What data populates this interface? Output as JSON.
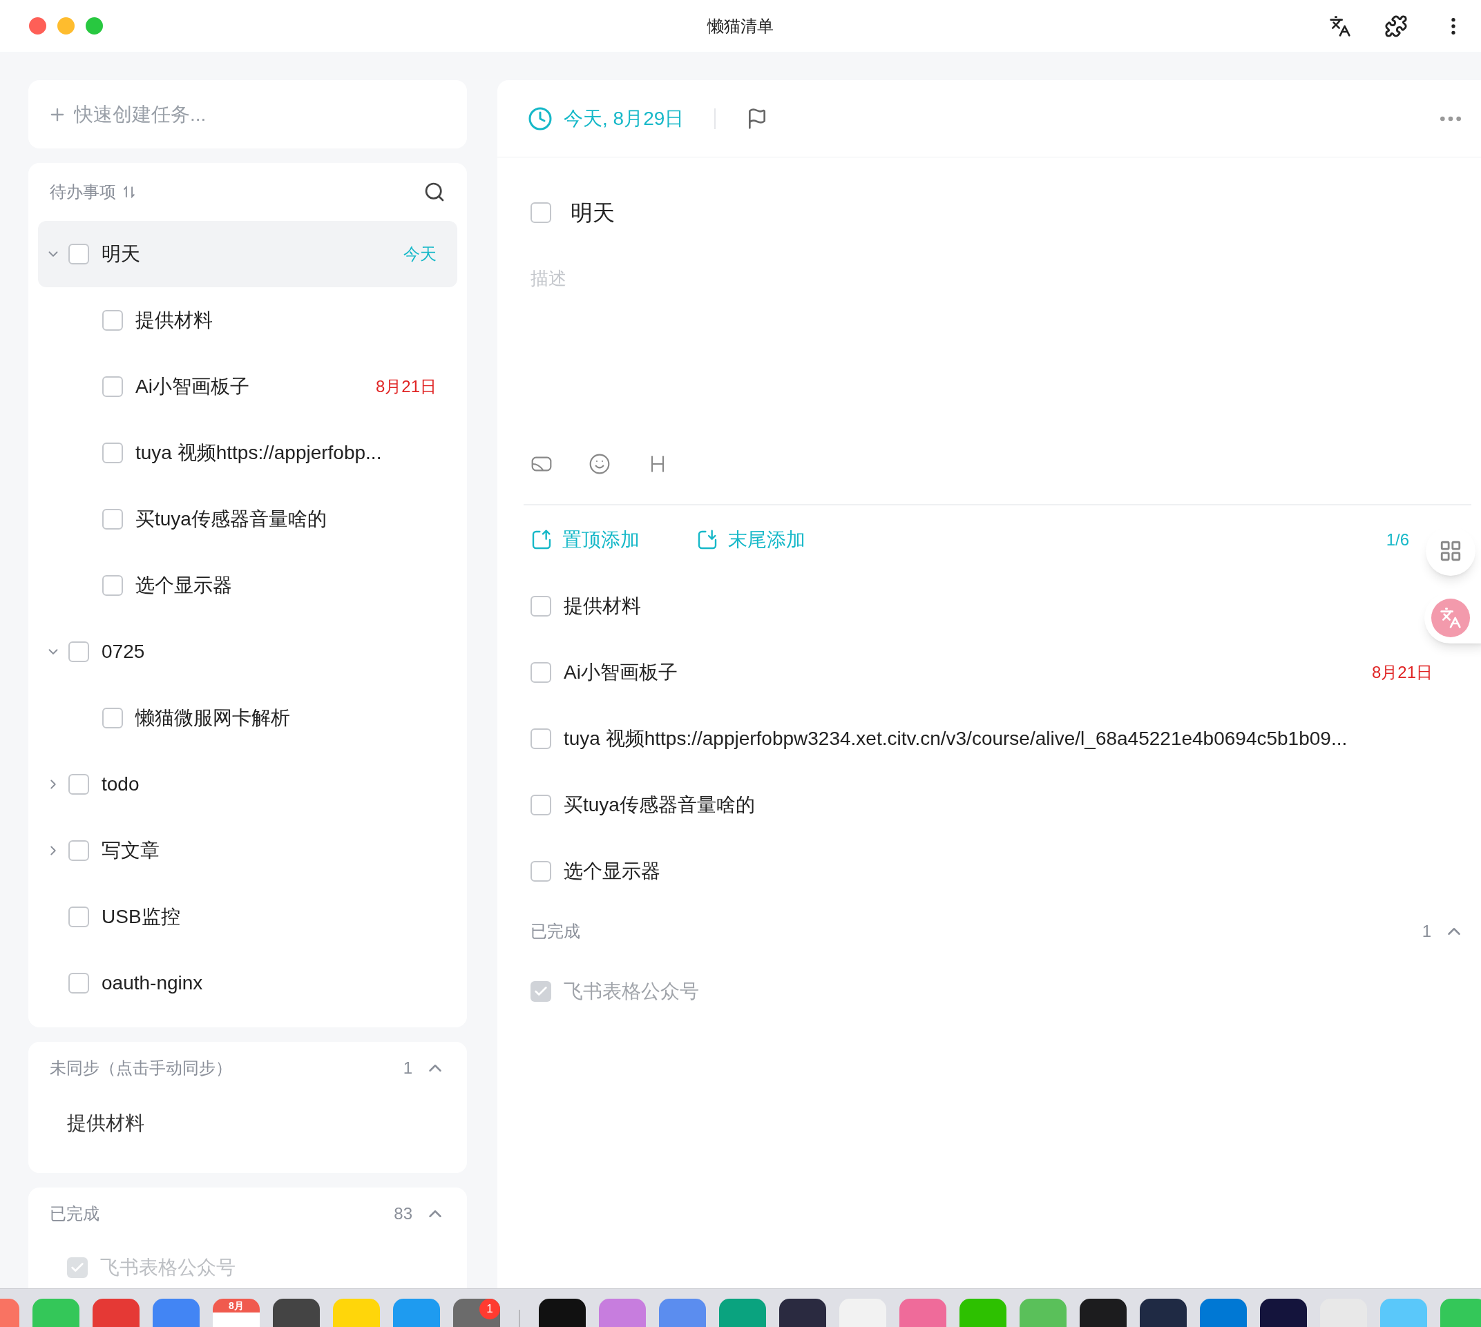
{
  "window": {
    "title": "懒猫清单"
  },
  "quick_create": {
    "placeholder": "快速创建任务..."
  },
  "todo_list": {
    "title": "待办事项",
    "items": [
      {
        "text": "明天",
        "checked": false,
        "selected": true,
        "expanded": true,
        "due": {
          "text": "今天",
          "kind": "today"
        },
        "children": [
          {
            "text": "提供材料",
            "checked": false,
            "selected": false
          },
          {
            "text": "Ai小智画板子",
            "checked": false,
            "selected": false,
            "due": {
              "text": "8月21日",
              "kind": "overdue"
            }
          },
          {
            "text": "tuya 视频https://appjerfobp...",
            "checked": false,
            "selected": false
          },
          {
            "text": "买tuya传感器音量啥的",
            "checked": false,
            "selected": false
          },
          {
            "text": "选个显示器",
            "checked": false,
            "selected": false
          }
        ]
      },
      {
        "text": "0725",
        "checked": false,
        "selected": false,
        "expanded": true,
        "children": [
          {
            "text": "懒猫微服网卡解析",
            "checked": false,
            "selected": false
          }
        ]
      },
      {
        "text": "todo",
        "checked": false,
        "selected": false,
        "expanded": false
      },
      {
        "text": "写文章",
        "checked": false,
        "selected": false,
        "expanded": false
      },
      {
        "text": "USB监控",
        "checked": false,
        "selected": false
      },
      {
        "text": "oauth-nginx",
        "checked": false,
        "selected": false
      }
    ]
  },
  "unsynced": {
    "title": "未同步（点击手动同步）",
    "count": "1",
    "expanded": true,
    "items": [
      "提供材料"
    ]
  },
  "completed": {
    "title": "已完成",
    "count": "83",
    "expanded": true,
    "items": [
      {
        "text": "飞书表格公众号",
        "checked": true
      }
    ]
  },
  "detail": {
    "date": "今天, 8月29日",
    "title": "明天",
    "checked": false,
    "description": {
      "placeholder": "描述"
    },
    "add_top": "置顶添加",
    "add_bottom": "末尾添加",
    "counter": "1/6",
    "subtasks": [
      {
        "text": "提供材料",
        "checked": false
      },
      {
        "text": "Ai小智画板子",
        "checked": false,
        "due": {
          "text": "8月21日",
          "kind": "overdue"
        }
      },
      {
        "text": "tuya 视频https://appjerfobpw3234.xet.citv.cn/v3/course/alive/l_68a45221e4b0694c5b1b09...",
        "checked": false
      },
      {
        "text": "买tuya传感器音量啥的",
        "checked": false
      },
      {
        "text": "选个显示器",
        "checked": false
      }
    ],
    "completed": {
      "title": "已完成",
      "count": "1",
      "expanded": true,
      "items": [
        {
          "text": "飞书表格公众号",
          "checked": true
        }
      ]
    }
  },
  "dock": [
    {
      "kind": "app",
      "color": "#f97362"
    },
    {
      "kind": "app",
      "color": "#34c759"
    },
    {
      "kind": "app",
      "color": "#e53935"
    },
    {
      "kind": "app",
      "color": "#4285f4"
    },
    {
      "kind": "calendar",
      "label": "8月"
    },
    {
      "kind": "app",
      "color": "#444444"
    },
    {
      "kind": "app",
      "color": "#ffd60a"
    },
    {
      "kind": "app",
      "color": "#1e9bf0"
    },
    {
      "kind": "app",
      "color": "#6b6b6b",
      "badge": "1"
    },
    {
      "kind": "separator"
    },
    {
      "kind": "app",
      "color": "#111111"
    },
    {
      "kind": "app",
      "color": "#c77dde"
    },
    {
      "kind": "app",
      "color": "#5b8def"
    },
    {
      "kind": "app",
      "color": "#0aa37f"
    },
    {
      "kind": "app",
      "color": "#2a2a40"
    },
    {
      "kind": "app",
      "color": "#f2f2f2"
    },
    {
      "kind": "app",
      "color": "#ef6b9a"
    },
    {
      "kind": "app",
      "color": "#2dc100"
    },
    {
      "kind": "app",
      "color": "#5ac05a"
    },
    {
      "kind": "app",
      "color": "#1c1c1e"
    },
    {
      "kind": "app",
      "color": "#1f2a44"
    },
    {
      "kind": "app",
      "color": "#0078d4"
    },
    {
      "kind": "app",
      "color": "#14143c"
    },
    {
      "kind": "app",
      "color": "#e8e8e8"
    },
    {
      "kind": "app",
      "color": "#5ac8fa"
    },
    {
      "kind": "app",
      "color": "#34c759"
    }
  ]
}
